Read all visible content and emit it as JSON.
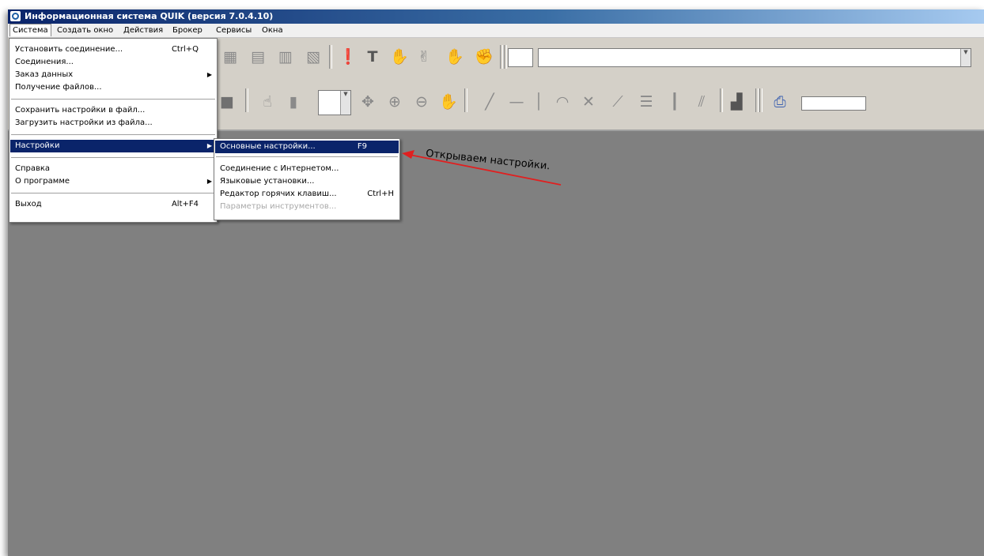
{
  "window": {
    "title": "Информационная система QUIK (версия 7.0.4.10)"
  },
  "menubar": {
    "items": [
      "Система",
      "Создать окно",
      "Действия",
      "Брокер",
      "Сервисы",
      "Окна"
    ]
  },
  "system_menu": {
    "items": [
      {
        "label": "Установить соединение...",
        "shortcut": "Ctrl+Q"
      },
      {
        "label": "Соединения...",
        "shortcut": ""
      },
      {
        "label": "Заказ данных",
        "shortcut": ""
      },
      {
        "label": "Получение файлов...",
        "shortcut": ""
      },
      {
        "label": "Сохранить настройки в файл...",
        "shortcut": ""
      },
      {
        "label": "Загрузить настройки из файла...",
        "shortcut": ""
      },
      {
        "label": "Настройки",
        "shortcut": ""
      },
      {
        "label": "Справка",
        "shortcut": ""
      },
      {
        "label": "О программе",
        "shortcut": ""
      },
      {
        "label": "Выход",
        "shortcut": "Alt+F4"
      }
    ]
  },
  "settings_submenu": {
    "items": [
      {
        "label": "Основные настройки...",
        "shortcut": "F9"
      },
      {
        "label": "Соединение с Интернетом...",
        "shortcut": ""
      },
      {
        "label": "Языковые установки...",
        "shortcut": ""
      },
      {
        "label": "Редактор горячих клавиш...",
        "shortcut": "Ctrl+H"
      },
      {
        "label": "Параметры инструментов...",
        "shortcut": ""
      }
    ]
  },
  "annotation": {
    "text": "Открываем настройки.",
    "color": "#e02020"
  },
  "colors": {
    "highlight": "#0a246a",
    "workspace": "#808080",
    "toolbar": "#d4d0c8"
  }
}
